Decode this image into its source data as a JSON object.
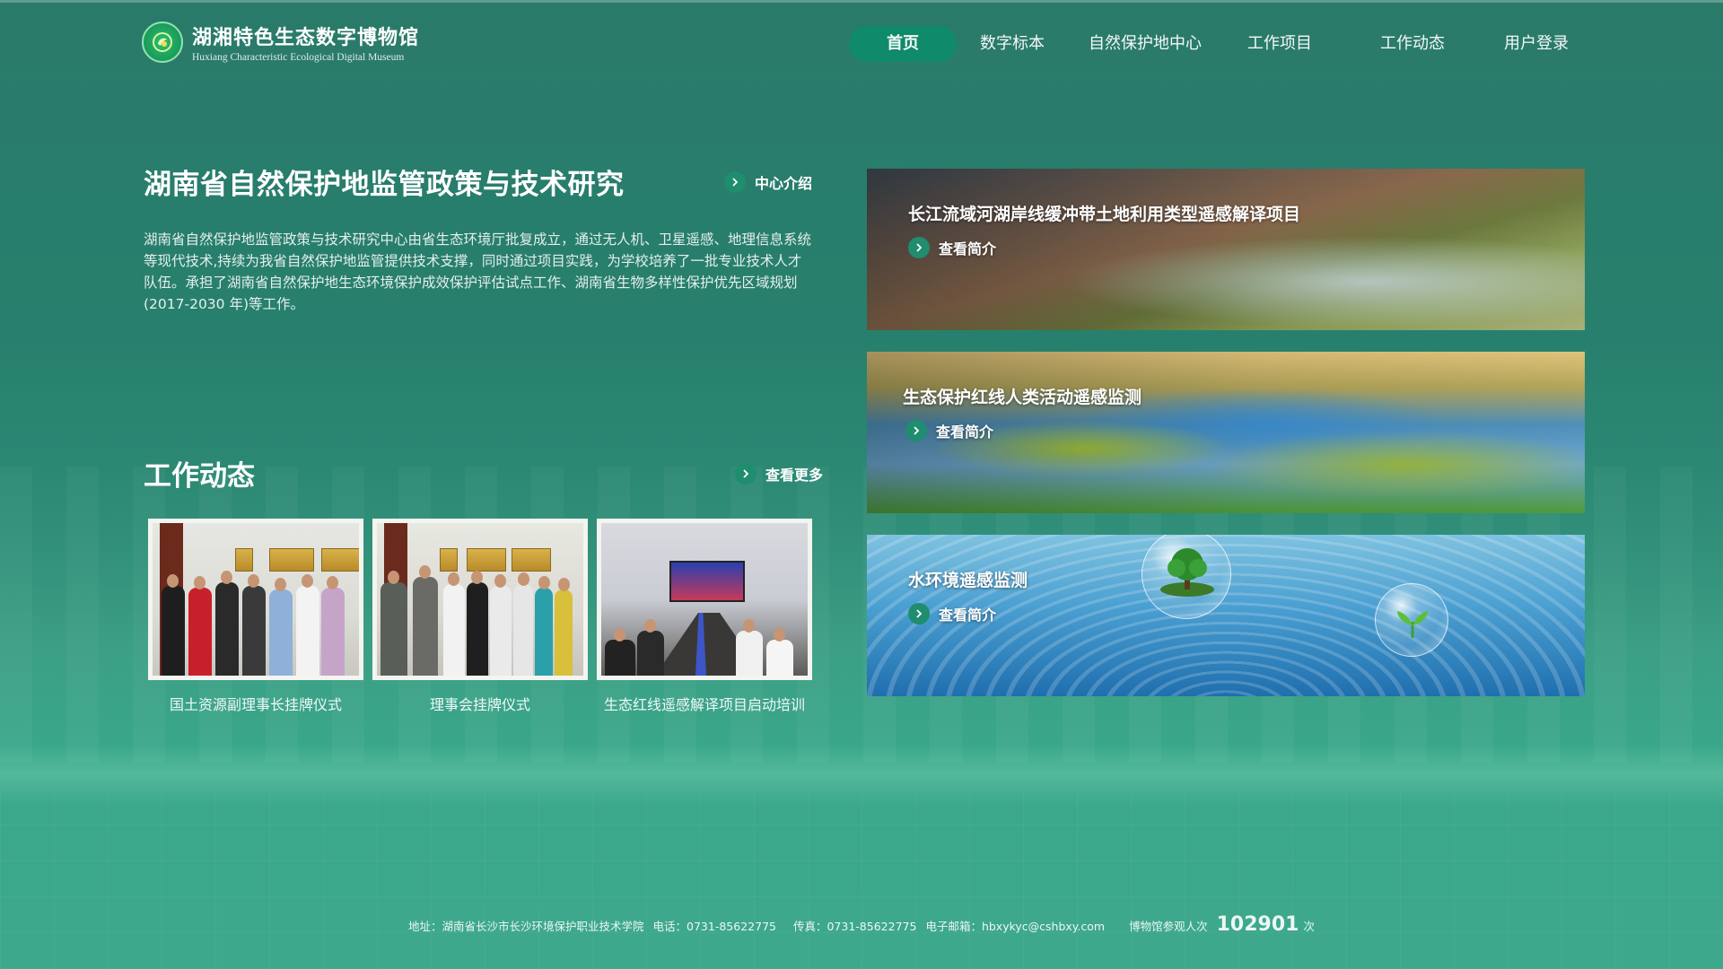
{
  "site": {
    "name_cn": "湖湘特色生态数字博物馆",
    "name_en": "Huxiang Characteristic Ecological Digital Museum"
  },
  "nav": [
    {
      "label": "首页",
      "active": true
    },
    {
      "label": "数字标本"
    },
    {
      "label": "自然保护地中心"
    },
    {
      "label": "工作项目"
    },
    {
      "label": "工作动态"
    },
    {
      "label": "用户登录"
    }
  ],
  "intro": {
    "title": "湖南省自然保护地监管政策与技术研究",
    "link": "中心介绍",
    "text": "湖南省自然保护地监管政策与技术研究中心由省生态环境厅批复成立，通过无人机、卫星遥感、地理信息系统等现代技术,持续为我省自然保护地监管提供技术支撑，同时通过项目实践，为学校培养了一批专业技术人才队伍。承担了湖南省自然保护地生态环境保护成效保护评估试点工作、湖南省生物多样性保护优先区域规划 (2017-2030 年)等工作。"
  },
  "news": {
    "title": "工作动态",
    "link": "查看更多",
    "items": [
      {
        "caption": "国土资源副理事长挂牌仪式"
      },
      {
        "caption": "理事会挂牌仪式"
      },
      {
        "caption": "生态红线遥感解译项目启动培训"
      }
    ]
  },
  "projects": [
    {
      "title": "长江流域河湖岸线缓冲带土地利用类型遥感解译项目",
      "link": "查看简介"
    },
    {
      "title": "生态保护红线人类活动遥感监测",
      "link": "查看简介"
    },
    {
      "title": "水环境遥感监测",
      "link": "查看简介"
    }
  ],
  "footer": {
    "address": "地址：湖南省长沙市长沙环境保护职业技术学院",
    "phone": "电话：0731-85622775",
    "fax": "传真：0731-85622775",
    "email": "电子邮箱：hbxykyc@cshbxy.com",
    "visits_label": "博物馆参观人次",
    "visits_count": "102901",
    "visits_unit": "次"
  },
  "colors": {
    "accent": "#0f8a6a",
    "background": "#2a7a6a"
  }
}
